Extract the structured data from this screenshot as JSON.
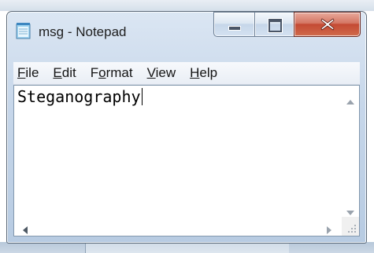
{
  "window": {
    "title": "msg - Notepad",
    "app_icon": "notepad-icon"
  },
  "caption_buttons": {
    "minimize": "minimize-icon",
    "maximize": "maximize-icon",
    "close": "close-icon"
  },
  "menubar": {
    "items": [
      {
        "label": "File",
        "mnemonic": "F",
        "rest": "ile"
      },
      {
        "label": "Edit",
        "mnemonic": "E",
        "rest": "dit"
      },
      {
        "label": "Format",
        "pre": "F",
        "mnemonic": "o",
        "rest": "rmat"
      },
      {
        "label": "View",
        "mnemonic": "V",
        "rest": "iew"
      },
      {
        "label": "Help",
        "mnemonic": "H",
        "rest": "elp"
      }
    ]
  },
  "editor": {
    "content": "Steganography"
  },
  "colors": {
    "window_frame": "#c7d7ea",
    "close_button": "#c44a33",
    "editor_bg": "#ffffff"
  }
}
